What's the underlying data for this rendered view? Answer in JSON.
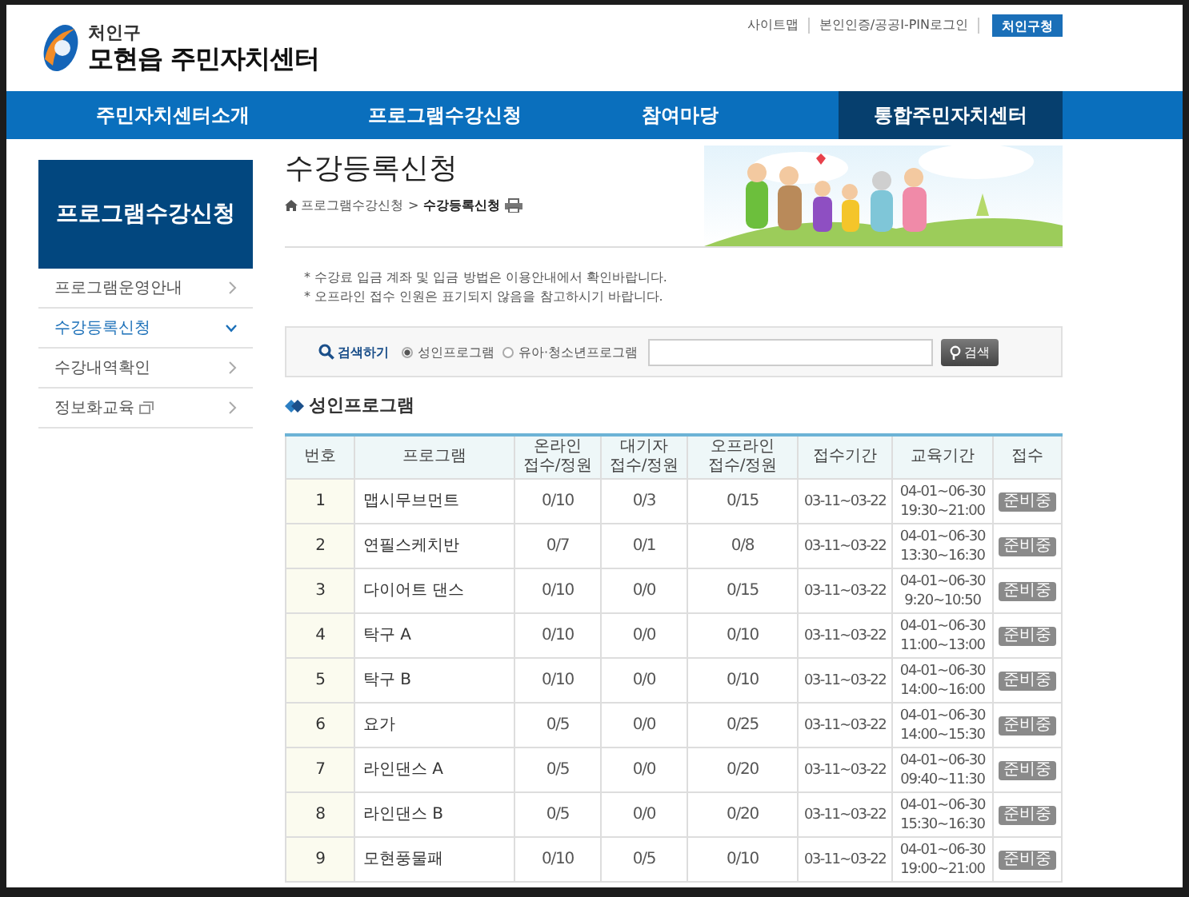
{
  "header": {
    "district": "처인구",
    "center_name": "모현읍 주민자치센터",
    "utility_links": [
      "사이트맵",
      "본인인증/공공I-PIN로그인"
    ],
    "district_button": "처인구청"
  },
  "nav": [
    {
      "label": "주민자치센터소개",
      "selected": false
    },
    {
      "label": "프로그램수강신청",
      "selected": false
    },
    {
      "label": "참여마당",
      "selected": false
    },
    {
      "label": "통합주민자치센터",
      "selected": true
    }
  ],
  "sidebar": {
    "title": "프로그램수강신청",
    "items": [
      {
        "label": "프로그램운영안내",
        "selected": false,
        "kind": "link"
      },
      {
        "label": "수강등록신청",
        "selected": true,
        "kind": "link"
      },
      {
        "label": "수강내역확인",
        "selected": false,
        "kind": "link"
      },
      {
        "label": "정보화교육",
        "selected": false,
        "kind": "external"
      }
    ]
  },
  "page": {
    "title": "수강등록신청",
    "breadcrumb": [
      "프로그램수강신청",
      "수강등록신청"
    ],
    "breadcrumb_separator": ">"
  },
  "notes": [
    "* 수강료 입금 계좌 및 입금 방법은 이용안내에서 확인바랍니다.",
    "* 오프라인 접수 인원은 표기되지 않음을 참고하시기 바랍니다."
  ],
  "search": {
    "label": "검색하기",
    "options": [
      {
        "label": "성인프로그램",
        "selected": true
      },
      {
        "label": "유아·청소년프로그램",
        "selected": false
      }
    ],
    "button": "검색"
  },
  "section_title": "성인프로그램",
  "table": {
    "columns": [
      "번호",
      "프로그램",
      "온라인\n접수/정원",
      "대기자\n접수/정원",
      "오프라인\n접수/정원",
      "접수기간",
      "교육기간",
      "접수"
    ],
    "rows": [
      {
        "no": "1",
        "program": "맵시무브먼트",
        "online": "0/10",
        "waiting": "0/3",
        "offline": "0/15",
        "apply_period": "03-11~03-22",
        "course_period": "04-01~06-30\n19:30~21:00",
        "status": "준비중"
      },
      {
        "no": "2",
        "program": "연필스케치반",
        "online": "0/7",
        "waiting": "0/1",
        "offline": "0/8",
        "apply_period": "03-11~03-22",
        "course_period": "04-01~06-30\n13:30~16:30",
        "status": "준비중"
      },
      {
        "no": "3",
        "program": "다이어트 댄스",
        "online": "0/10",
        "waiting": "0/0",
        "offline": "0/15",
        "apply_period": "03-11~03-22",
        "course_period": "04-01~06-30\n9:20~10:50",
        "status": "준비중"
      },
      {
        "no": "4",
        "program": "탁구 A",
        "online": "0/10",
        "waiting": "0/0",
        "offline": "0/10",
        "apply_period": "03-11~03-22",
        "course_period": "04-01~06-30\n11:00~13:00",
        "status": "준비중"
      },
      {
        "no": "5",
        "program": "탁구 B",
        "online": "0/10",
        "waiting": "0/0",
        "offline": "0/10",
        "apply_period": "03-11~03-22",
        "course_period": "04-01~06-30\n14:00~16:00",
        "status": "준비중"
      },
      {
        "no": "6",
        "program": "요가",
        "online": "0/5",
        "waiting": "0/0",
        "offline": "0/25",
        "apply_period": "03-11~03-22",
        "course_period": "04-01~06-30\n14:00~15:30",
        "status": "준비중"
      },
      {
        "no": "7",
        "program": "라인댄스 A",
        "online": "0/5",
        "waiting": "0/0",
        "offline": "0/20",
        "apply_period": "03-11~03-22",
        "course_period": "04-01~06-30\n09:40~11:30",
        "status": "준비중"
      },
      {
        "no": "8",
        "program": "라인댄스 B",
        "online": "0/5",
        "waiting": "0/0",
        "offline": "0/20",
        "apply_period": "03-11~03-22",
        "course_period": "04-01~06-30\n15:30~16:30",
        "status": "준비중"
      },
      {
        "no": "9",
        "program": "모현풍물패",
        "online": "0/10",
        "waiting": "0/5",
        "offline": "0/10",
        "apply_period": "03-11~03-22",
        "course_period": "04-01~06-30\n19:00~21:00",
        "status": "준비중"
      }
    ]
  }
}
